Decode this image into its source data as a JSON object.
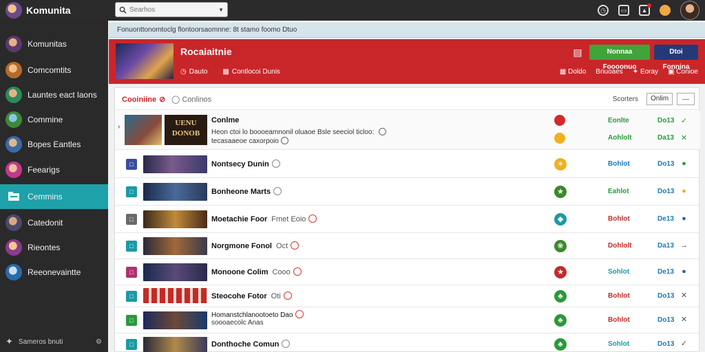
{
  "topbar": {
    "app_name": "Komunita",
    "search_placeholder": "Searhos",
    "icons": [
      "clock-icon",
      "bag-icon",
      "bell-icon",
      "coin-icon",
      "profile-avatar"
    ]
  },
  "sidebar": {
    "items": [
      {
        "label": "Komunitas"
      },
      {
        "label": "Comcomtits"
      },
      {
        "label": "Launtes eact laons"
      },
      {
        "label": "Commine"
      },
      {
        "label": "Bopes Eantles"
      },
      {
        "label": "Feearigs"
      },
      {
        "label": "Cemmins"
      },
      {
        "label": "Catedonit"
      },
      {
        "label": "Rieontes"
      },
      {
        "label": "Reeonevaintte"
      }
    ],
    "active_index": 6,
    "footer": "Sameros bnuti"
  },
  "notice": {
    "text": "Fonuonttonomtoclg flontoorsaomnne:  8t stamo foomo  Dtuo"
  },
  "banner": {
    "title": "Rocaiaitnie",
    "meta": [
      {
        "icon": "clock-icon",
        "label": "Dauto"
      },
      {
        "icon": "doc-icon",
        "label": "Contlocoi Dunis"
      }
    ],
    "primary_button": "Nonnaa Foooonuo",
    "secondary_button": "Dtoi Fonnina",
    "stats": [
      {
        "icon": "grid-icon",
        "label": "Doldo"
      },
      {
        "icon": "",
        "label": "Bnuoaes"
      },
      {
        "icon": "star-icon",
        "label": "Eoray"
      },
      {
        "icon": "lock-icon",
        "label": "Conioe"
      }
    ]
  },
  "list": {
    "tabs": [
      "Cooiniine",
      "Conlinos"
    ],
    "sort_label": "Scorters",
    "sort_value": "Onlim",
    "sort_extra": "‒‒",
    "featured": {
      "title": "Conlme",
      "cover_text": "UENU DONOB",
      "desc_line1": "Heon ctoi lo boooeamnonil oluaoe Bsle seeciol ticloo:",
      "desc_line2": "tecasaaeoe caxorpoio",
      "statuses": [
        "Eonlte",
        "Aohlolt"
      ],
      "values": [
        "Do13",
        "Da13"
      ],
      "actions": [
        "✓",
        "✕"
      ]
    },
    "rows": [
      {
        "name": "Nontsecy Dunin",
        "sub": "",
        "status": "Bohlot",
        "status_color": "b",
        "value": "Do13",
        "action": "●",
        "badge_color": "#3a4ea0",
        "game_icon": "#f0b020",
        "game_glyph": "✶"
      },
      {
        "name": "Bonheone Marts",
        "sub": "",
        "status": "Eahlot",
        "status_color": "g",
        "value": "Do13",
        "action": "●",
        "badge_color": "#1a9aa6",
        "game_icon": "#3a8a2a",
        "game_glyph": "★"
      },
      {
        "name": "Moetachie Foor",
        "sub": "Fmet Eoio",
        "status": "Bohlot",
        "status_color": "r",
        "value": "De13",
        "action": "●",
        "badge_color": "#6a6a6a",
        "game_icon": "#1a9aa6",
        "game_glyph": "◆"
      },
      {
        "name": "Norgmone Fonol",
        "sub": "Oct",
        "status": "Dohlolt",
        "status_color": "r",
        "value": "Da13",
        "action": "→",
        "badge_color": "#1a9aa6",
        "game_icon": "#3a8a2a",
        "game_glyph": "❀"
      },
      {
        "name": "Monoone Colim",
        "sub": "Cooo",
        "status": "Sohlot",
        "status_color": "t",
        "value": "De13",
        "action": "●",
        "badge_color": "#b03070",
        "game_icon": "#c42a2a",
        "game_glyph": "★"
      },
      {
        "name": "Steocohe Fotor",
        "sub": "Oti",
        "status": "Bohlot",
        "status_color": "r",
        "value": "Do13",
        "action": "✕",
        "badge_color": "#1a9aa6",
        "game_icon": "#2a9a3a",
        "game_glyph": "♣"
      },
      {
        "name": "Homanstchlanootoeto Dao",
        "sub": "",
        "status": "Bohlot",
        "status_color": "r",
        "value": "Do13",
        "action": "✕",
        "badge_color": "#2a9a3a",
        "game_icon": "#2a9a3a",
        "game_glyph": "♣"
      },
      {
        "name": "Donthoche Comun",
        "sub": "",
        "status": "Sohlot",
        "status_color": "t",
        "value": "Do13",
        "action": "✓",
        "badge_color": "#1a9aa6",
        "game_icon": "#2a9a3a",
        "game_glyph": "♣"
      }
    ],
    "row7_line2": "soooaecolc Anas"
  },
  "colors": {
    "topbar_bg": "#2b2b2b",
    "sidebar_bg": "#2a2a2a",
    "sidebar_active": "#1fa1aa",
    "banner_red": "#c9262a",
    "primary_green": "#3fa43a",
    "secondary_navy": "#243a78"
  }
}
